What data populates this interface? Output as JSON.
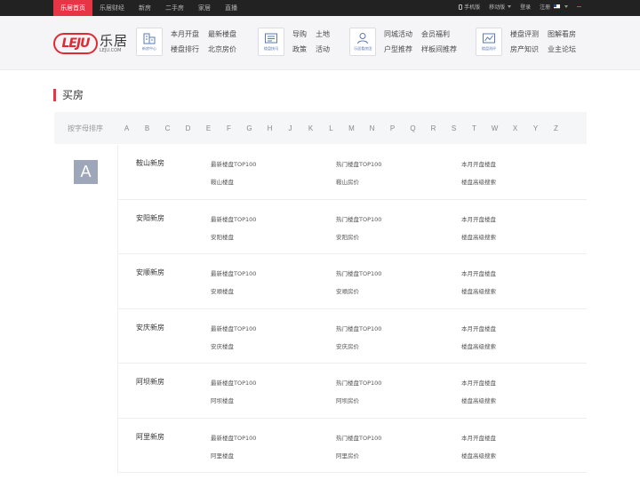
{
  "topbar": {
    "nav": [
      "乐居首页",
      "乐居财经",
      "新房",
      "二手房",
      "家居",
      "直播"
    ],
    "mobile_label": "手机版",
    "channel_label": "移动版",
    "login_label": "登录",
    "register_label": "注册"
  },
  "logo": {
    "cn": "乐居",
    "en": "LEJU.COM",
    "mark": "LEJU"
  },
  "header": {
    "groups": [
      {
        "icon": "building-icon",
        "icon_label": "新房中心",
        "links": [
          "本月开盘",
          "最新楼盘",
          "楼盘排行",
          "北京房价"
        ]
      },
      {
        "icon": "news-icon",
        "icon_label": "楼盘快讯",
        "links": [
          "导购",
          "土地",
          "政策",
          "活动"
        ]
      },
      {
        "icon": "user-icon",
        "icon_label": "乐居看房团",
        "links": [
          "同城活动",
          "会员福利",
          "户型推荐",
          "样板间推荐"
        ]
      },
      {
        "icon": "chart-icon",
        "icon_label": "楼盘测评",
        "links": [
          "楼盘评测",
          "图解看房",
          "房产知识",
          "业主论坛"
        ]
      }
    ]
  },
  "section": {
    "title": "买房"
  },
  "letters": {
    "label": "按字母排序",
    "items": [
      "A",
      "B",
      "C",
      "D",
      "E",
      "F",
      "G",
      "H",
      "J",
      "K",
      "L",
      "M",
      "N",
      "P",
      "Q",
      "R",
      "S",
      "T",
      "W",
      "X",
      "Y",
      "Z"
    ]
  },
  "current_letter": "A",
  "cities": [
    {
      "name": "鞍山新房",
      "links": [
        "最新楼盘TOP100",
        "热门楼盘TOP100",
        "本月开盘楼盘",
        "鞍山楼盘",
        "鞍山房价",
        "楼盘高级搜索"
      ]
    },
    {
      "name": "安阳新房",
      "links": [
        "最新楼盘TOP100",
        "热门楼盘TOP100",
        "本月开盘楼盘",
        "安阳楼盘",
        "安阳房价",
        "楼盘高级搜索"
      ]
    },
    {
      "name": "安顺新房",
      "links": [
        "最新楼盘TOP100",
        "热门楼盘TOP100",
        "本月开盘楼盘",
        "安顺楼盘",
        "安顺房价",
        "楼盘高级搜索"
      ]
    },
    {
      "name": "安庆新房",
      "links": [
        "最新楼盘TOP100",
        "热门楼盘TOP100",
        "本月开盘楼盘",
        "安庆楼盘",
        "安庆房价",
        "楼盘高级搜索"
      ]
    },
    {
      "name": "阿坝新房",
      "links": [
        "最新楼盘TOP100",
        "热门楼盘TOP100",
        "本月开盘楼盘",
        "阿坝楼盘",
        "阿坝房价",
        "楼盘高级搜索"
      ]
    },
    {
      "name": "阿里新房",
      "links": [
        "最新楼盘TOP100",
        "热门楼盘TOP100",
        "本月开盘楼盘",
        "阿里楼盘",
        "阿里房价",
        "楼盘高级搜索"
      ]
    }
  ],
  "colors": {
    "accent": "#e83545",
    "topbar": "#222222",
    "badge": "#9ea6b9",
    "icon_blue": "#5a79b8"
  }
}
